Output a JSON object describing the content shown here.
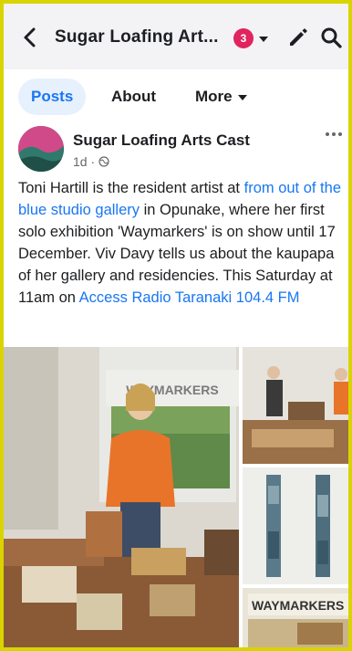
{
  "header": {
    "title": "Sugar Loafing Art...",
    "notification_count": "3"
  },
  "tabs": [
    {
      "label": "Posts"
    },
    {
      "label": "About"
    },
    {
      "label": "More"
    }
  ],
  "post": {
    "author": "Sugar Loafing Arts Cast",
    "time": "1d ·",
    "text_parts": {
      "p1": "Toni Hartill is the resident artist at ",
      "link1": "from out of the blue studio gallery",
      "p2": " in Opunake, where her first solo exhibition 'Waymarkers' is on show until 17 December. Viv Davy tells us about the kaupapa of her gallery and residencies. This Saturday at 11am on ",
      "link2": "Access Radio Taranaki 104.4 FM"
    },
    "photo_text": {
      "banner": "WAYMARKERS",
      "poster": "WAYMARKERS"
    }
  },
  "colors": {
    "accent": "#1877f2",
    "badge": "#e0245e",
    "frame": "#d9d400"
  },
  "icons": [
    "back-arrow-icon",
    "chevron-down-icon",
    "pencil-icon",
    "search-icon",
    "globe-icon",
    "more-dots-icon"
  ]
}
